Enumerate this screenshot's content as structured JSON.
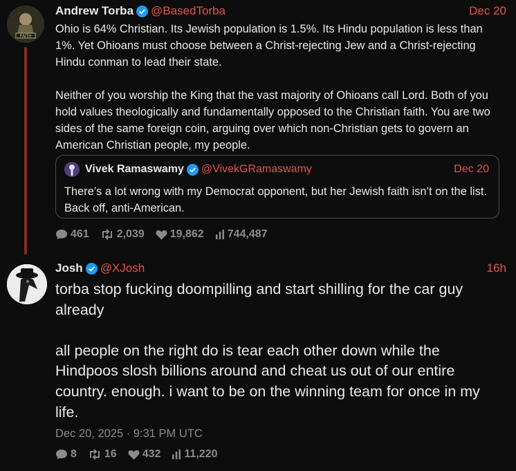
{
  "post1": {
    "author": "Andrew Torba",
    "handle": "@BasedTorba",
    "time": "Dec 20",
    "avatar_icon": "based-shield-icon",
    "text": "Ohio is 64% Christian. Its Jewish population is 1.5%. Its Hindu population is less than 1%. Yet Ohioans must choose between a Christ-rejecting Jew and a Christ-rejecting Hindu conman to lead their state.\n\nNeither of you worship the King that the vast majority of Ohioans call Lord. Both of you hold values theologically and fundamentally opposed to the Christian faith. You are two sides of the same foreign coin, arguing over which non-Christian gets to govern an American Christian people, my people.",
    "quote": {
      "author": "Vivek Ramaswamy",
      "handle": "@VivekGRamaswamy",
      "time": "Dec 20",
      "text": "There’s a lot wrong with my Democrat opponent, but her Jewish faith isn’t on the list. Back off, anti-American."
    },
    "stats": {
      "replies": "461",
      "reposts": "2,039",
      "likes": "19,862",
      "views": "744,487"
    }
  },
  "post2": {
    "author": "Josh",
    "handle": "@XJosh",
    "time": "16h",
    "text": "torba stop fucking doompilling and start shilling for the car guy already\n\nall people on the right do is tear each other down while the Hindpoos slosh billions around and cheat us out of our entire country. enough. i want to be on the winning team for once in my life.",
    "datestamp": "Dec 20, 2025 · 9:31 PM UTC",
    "stats": {
      "replies": "8",
      "reposts": "16",
      "likes": "432",
      "views": "11,220"
    }
  },
  "colors": {
    "accent": "#e0574e",
    "muted": "#8b8b8b",
    "verified": "#1d9bf0",
    "thread": "#8a2a24"
  }
}
